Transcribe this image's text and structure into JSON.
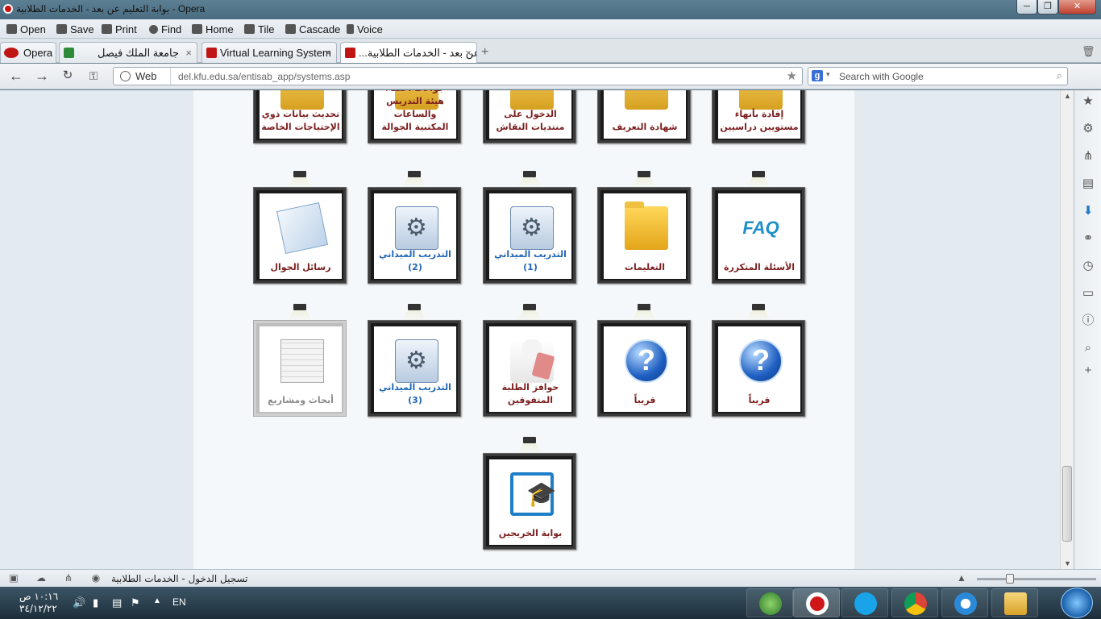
{
  "window": {
    "title": "بوابة التعليم عن بعد - الخدمات الطلابية - Opera",
    "min_label": "─",
    "max_label": "❐",
    "close_label": "✕"
  },
  "toolbar": {
    "items": [
      {
        "label": "Open",
        "icon": "folder-icon"
      },
      {
        "label": "Save",
        "icon": "save-icon"
      },
      {
        "label": "Print",
        "icon": "printer-icon"
      },
      {
        "label": "Find",
        "icon": "search-icon"
      },
      {
        "label": "Home",
        "icon": "home-icon"
      },
      {
        "label": "Tile",
        "icon": "tile-icon"
      },
      {
        "label": "Cascade",
        "icon": "cascade-icon"
      },
      {
        "label": "Voice",
        "icon": "microphone-icon"
      }
    ]
  },
  "tabs": [
    {
      "label": "Opera",
      "icon": "opera-icon"
    },
    {
      "label": "جامعة الملك فيصل",
      "icon": "kfu-icon"
    },
    {
      "label": "Virtual Learning System",
      "icon": "kfu-red-icon"
    },
    {
      "label": "...ا عن بعد - الخدمات الطلابية",
      "icon": "kfu-red-icon"
    }
  ],
  "address": {
    "mode_label": "Web",
    "url": "del.kfu.edu.sa/entisab_app/systems.asp",
    "search_placeholder": "Search with Google"
  },
  "tiles": [
    {
      "label": "إفادة بأنهاء مستويين دراسيين",
      "style": "red",
      "art": "partial"
    },
    {
      "label": "شهادة التعريف",
      "style": "red",
      "art": "partial"
    },
    {
      "label": "الدخول على منتديات النقاش",
      "style": "red",
      "art": "partial"
    },
    {
      "label": "جوالات أعضاء هيئة التدريس والساعات المكتبية الجوالة",
      "style": "red",
      "art": "partial"
    },
    {
      "label": "تحديث بيانات ذوي الإحتياجات الخاصة",
      "style": "red",
      "art": "partial"
    },
    {
      "label": "الأسئلة المتكررة",
      "style": "red",
      "art": "faq"
    },
    {
      "label": "التعليمات",
      "style": "red",
      "art": "folder"
    },
    {
      "label": "التدريب الميداني (1)",
      "style": "blue",
      "art": "gear"
    },
    {
      "label": "التدريب الميداني (2)",
      "style": "blue",
      "art": "gear"
    },
    {
      "label": "رسائل الجوال",
      "style": "red",
      "art": "mail"
    },
    {
      "label": "قريباً",
      "style": "red",
      "art": "question"
    },
    {
      "label": "قريباً",
      "style": "red",
      "art": "question"
    },
    {
      "label": "حوافز الطلبة المتفوقين",
      "style": "red",
      "art": "person"
    },
    {
      "label": "التدريب الميداني (3)",
      "style": "blue",
      "art": "gear"
    },
    {
      "label": "أبحاث ومشاريع",
      "style": "gray",
      "art": "sheet"
    },
    {
      "label": "بوابة الخريجين",
      "style": "red",
      "art": "grad"
    }
  ],
  "faq_art_text": "FAQ",
  "question_glyph": "?",
  "status": {
    "text": "تسجيل الدخول - الخدمات الطلابية"
  },
  "taskbar": {
    "time": "١٠:١٦ ص",
    "date": "٣٤/١٢/٢٢",
    "lang": "EN"
  }
}
